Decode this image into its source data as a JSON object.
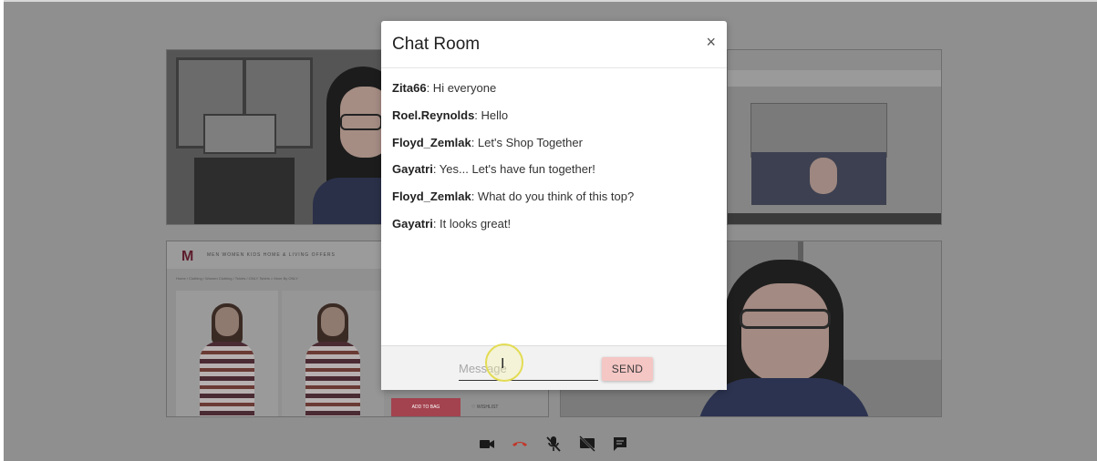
{
  "modal": {
    "title": "Chat Room",
    "close_label": "×",
    "messages": [
      {
        "user": "Zita66",
        "text": ": Hi everyone"
      },
      {
        "user": "Roel.Reynolds",
        "text": ": Hello"
      },
      {
        "user": "Floyd_Zemlak",
        "text": ": Let's Shop Together"
      },
      {
        "user": "Gayatri",
        "text": ": Yes... Let's have fun together!"
      },
      {
        "user": "Floyd_Zemlak",
        "text": ": What do you think of this top?"
      },
      {
        "user": "Gayatri",
        "text": ": It looks great!"
      }
    ],
    "input_placeholder": "Message",
    "send_label": "SEND"
  },
  "shop": {
    "logo": "M",
    "menu": "MEN   WOMEN   KIDS   HOME & LIVING   OFFERS",
    "crumb": "Home / Clothing / Women Clothing / Tshirts / ONLY Tshirts > More By ONLY",
    "add_to_bag": "ADD TO BAG",
    "wishlist": "♡ WISHLIST"
  },
  "controls": {
    "icons": [
      "video-camera-icon",
      "hang-up-icon",
      "mic-off-icon",
      "screen-share-off-icon",
      "chat-icon"
    ]
  },
  "colors": {
    "send_button": "#f4c6c4",
    "hangup": "#c0392b",
    "icon": "#1a1a1a"
  }
}
